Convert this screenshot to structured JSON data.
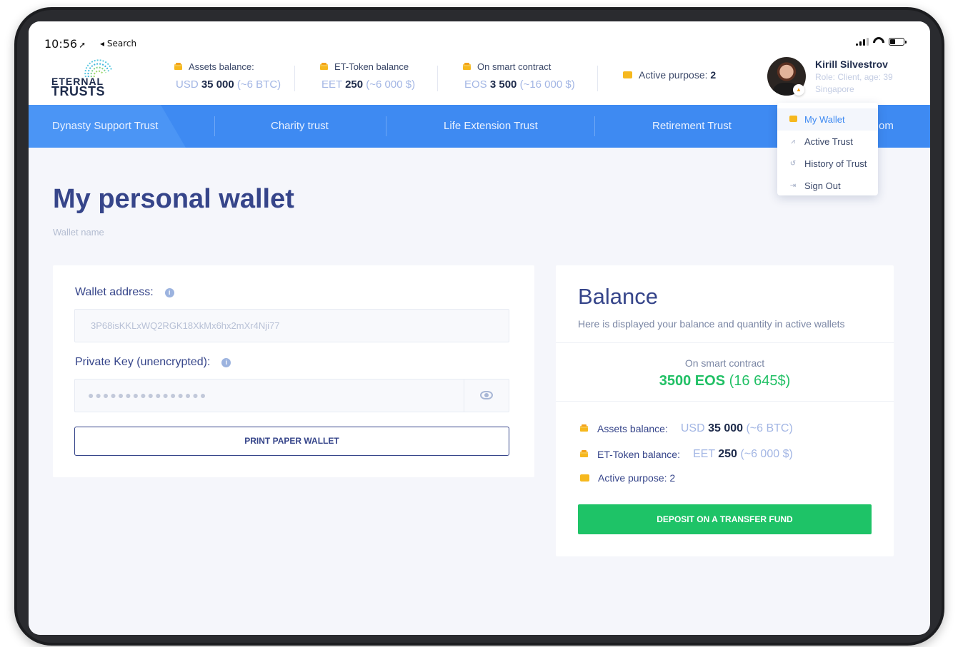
{
  "status_bar": {
    "time": "10:56",
    "back_label": "◂ Search",
    "battery_level": 0.4
  },
  "logo": {
    "line1": "ETERNAL",
    "line2": "TRUSTS"
  },
  "header_stats": [
    {
      "label": "Assets balance:",
      "unit": "USD",
      "amount": "35 000",
      "approx": "(~6 BTC)"
    },
    {
      "label": "ET-Token balance",
      "unit": "EET",
      "amount": "250",
      "approx": "(~6 000 $)"
    },
    {
      "label": "On smart contract",
      "unit": "EOS",
      "amount": "3 500",
      "approx": "(~16 000 $)"
    }
  ],
  "active_purpose": {
    "label": "Active purpose:",
    "count": "2"
  },
  "user": {
    "name": "Kirill Silvestrov",
    "role": "Role: Client, age: 39",
    "city": "Singapore"
  },
  "nav": {
    "tabs": [
      {
        "label": "Dynasty Support Trust"
      },
      {
        "label": "Charity trust"
      },
      {
        "label": "Life Extension Trust"
      },
      {
        "label": "Retirement Trust"
      },
      {
        "label": "om"
      }
    ]
  },
  "user_menu": {
    "items": [
      {
        "label": "My Wallet",
        "icon": "wallet-icon"
      },
      {
        "label": "Active Trust",
        "icon": "chart-icon"
      },
      {
        "label": "History of Trust",
        "icon": "history-icon"
      },
      {
        "label": "Sign Out",
        "icon": "sign-out-icon"
      }
    ]
  },
  "page": {
    "title": "My personal wallet",
    "subtitle": "Wallet name"
  },
  "wallet_form": {
    "address_label": "Wallet address:",
    "address_value": "3P68isKKLxWQ2RGK18XkMx6hx2mXr4Nji77",
    "private_key_label": "Private Key (unencrypted):",
    "private_key_masked": "●●●●●●●●●●●●●●●●",
    "print_button": "PRINT PAPER WALLET"
  },
  "balance": {
    "title": "Balance",
    "subtitle": "Here is displayed your balance and quantity in active wallets",
    "smart_contract_label": "On smart contract",
    "smart_contract_amount": "3500 EOS",
    "smart_contract_usd": "(16 645$)",
    "rows": [
      {
        "label": "Assets balance:",
        "unit": "USD",
        "amount": "35 000",
        "approx": "(~6 BTC)"
      },
      {
        "label": "ET-Token balance:",
        "unit": "EET",
        "amount": "250",
        "approx": "(~6 000 $)"
      }
    ],
    "active_purpose": "Active purpose: 2",
    "deposit_button": "DEPOSIT ON A TRANSFER FUND"
  },
  "colors": {
    "nav_blue": "#3e8af2",
    "title_navy": "#36458a",
    "accent_green": "#1ec367",
    "coin_gold": "#f6b81e"
  }
}
